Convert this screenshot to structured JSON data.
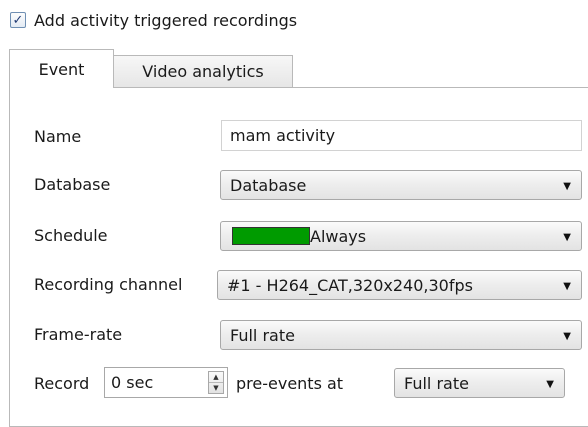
{
  "header": {
    "checkbox_checked": true,
    "checkbox_label": "Add activity triggered recordings"
  },
  "tabs": [
    {
      "label": "Event",
      "active": true
    },
    {
      "label": "Video analytics",
      "active": false
    }
  ],
  "form": {
    "name_label": "Name",
    "name_value": "mam activity",
    "database_label": "Database",
    "database_value": "Database",
    "schedule_label": "Schedule",
    "schedule_value": "Always",
    "schedule_color": "#009b00",
    "channel_label": "Recording channel",
    "channel_value": "#1 - H264_CAT,320x240,30fps",
    "framerate_label": "Frame-rate",
    "framerate_value": "Full rate",
    "record_label": "Record",
    "record_value": "0 sec",
    "pre_events_label": "pre-events at",
    "pre_events_rate": "Full rate"
  },
  "icons": {
    "checkbox": "checkmark-icon",
    "dropdown": "chevron-down-icon",
    "spin_up": "spin-up-icon",
    "spin_down": "spin-down-icon"
  }
}
